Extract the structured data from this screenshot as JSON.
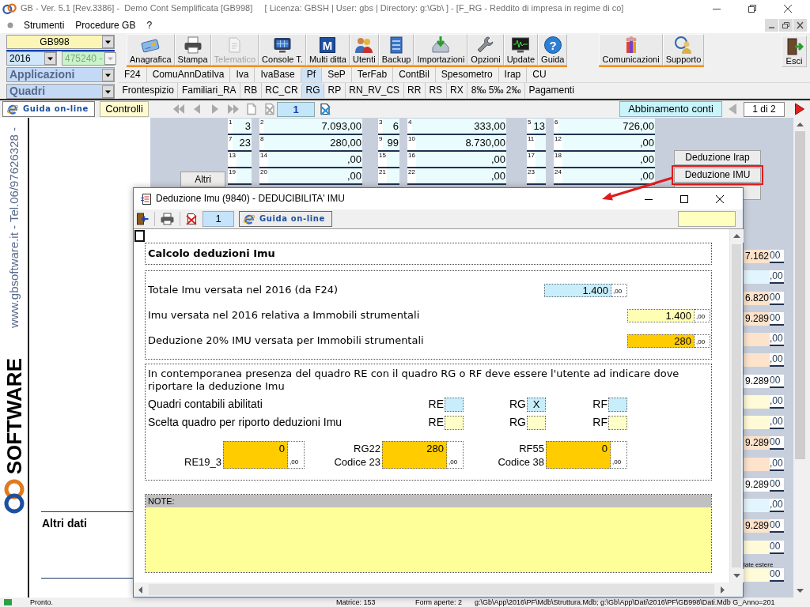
{
  "window": {
    "title": "GB - Ver. 5.1 [Rev.3386] -  Demo Cont Semplificata [GB998]     [ Licenza: GBSH | User: gbs | Directory: g:\\Gb\\ ] - [F_RG - Reddito di impresa in regime di co]"
  },
  "menu": [
    "Strumenti",
    "Procedure GB",
    "?"
  ],
  "selectors": {
    "company": "GB998",
    "year": "2016",
    "code": {
      "value": "475240 -",
      "disabled": true
    },
    "applications": "Applicazioni",
    "sections": "Quadri"
  },
  "toolbar_groups": [
    {
      "buttons": [
        {
          "label": "Anagrafica",
          "kind": "registry",
          "disabled": false
        },
        {
          "label": "Stampa",
          "kind": "print",
          "disabled": false
        },
        {
          "label": "Telematico",
          "kind": "telematic",
          "disabled": true
        },
        {
          "label": "Console T.",
          "kind": "console",
          "disabled": false
        },
        {
          "label": "Multi ditta",
          "kind": "multi",
          "glyph": "M",
          "disabled": false
        },
        {
          "label": "Utenti",
          "kind": "users",
          "disabled": false
        },
        {
          "label": "Backup",
          "kind": "backup",
          "disabled": false
        },
        {
          "label": "Importazioni",
          "kind": "import",
          "disabled": false
        },
        {
          "label": "Opzioni",
          "kind": "options",
          "disabled": false
        },
        {
          "label": "Update",
          "kind": "update",
          "disabled": false
        },
        {
          "label": "Guida",
          "kind": "help",
          "glyph": "?",
          "disabled": false
        }
      ]
    },
    {
      "buttons": [
        {
          "label": "Comunicazioni",
          "kind": "messages",
          "disabled": false
        },
        {
          "label": "Supporto",
          "kind": "support",
          "disabled": false
        }
      ]
    },
    {
      "buttons": [
        {
          "label": "Esci",
          "kind": "exit",
          "disabled": false
        }
      ]
    }
  ],
  "app_tabs": [
    {
      "label": "F24",
      "selected": false
    },
    {
      "label": "ComuAnnDatiIva",
      "selected": false
    },
    {
      "label": "Iva",
      "selected": false
    },
    {
      "label": "IvaBase",
      "selected": false
    },
    {
      "label": "Pf",
      "selected": true
    },
    {
      "label": "SeP",
      "selected": false
    },
    {
      "label": "TerFab",
      "selected": false
    },
    {
      "label": "ContBil",
      "selected": false
    },
    {
      "label": "Spesometro",
      "selected": false
    },
    {
      "label": "Irap",
      "selected": false
    },
    {
      "label": "CU",
      "selected": false
    }
  ],
  "section_tabs": [
    {
      "label": "Frontespizio",
      "selected": false
    },
    {
      "label": "Familiari_RA",
      "selected": false
    },
    {
      "label": "RB",
      "selected": false
    },
    {
      "label": "RC_CR",
      "selected": false
    },
    {
      "label": "RG",
      "selected": true
    },
    {
      "label": "RP",
      "selected": false
    },
    {
      "label": "RN_RV_CS",
      "selected": false
    },
    {
      "label": "RR",
      "selected": false
    },
    {
      "label": "RS",
      "selected": false
    },
    {
      "label": "RX",
      "selected": false
    },
    {
      "label": "8‰ 5‰ 2‰",
      "selected": false
    },
    {
      "label": "Pagamenti",
      "selected": false
    }
  ],
  "nav_bar": {
    "help_button": "Guida on-line",
    "checks_button": "Controlli",
    "record": "1",
    "link_button": "Abbinamento conti",
    "page": "1 di 2"
  },
  "side_banner": {
    "contact": "www.gbsoftware.it - Tel.06/97626328 -",
    "logo_text": "SOFTWARE"
  },
  "form": {
    "grid_rows": [
      {
        "cells": [
          {
            "number": "1",
            "value": "3"
          },
          {
            "number": "2",
            "value": "7.093,00"
          },
          {
            "number": "3",
            "value": "6"
          },
          {
            "number": "4",
            "value": "333,00"
          },
          {
            "number": "5",
            "value": "13"
          },
          {
            "number": "6",
            "value": "726,00"
          }
        ]
      },
      {
        "cells": [
          {
            "number": "7",
            "value": "23"
          },
          {
            "number": "8",
            "value": "280,00"
          },
          {
            "number": "9",
            "value": "99"
          },
          {
            "number": "10",
            "value": "8.730,00"
          },
          {
            "number": "11"
          },
          {
            "number": "12",
            "value": ",00"
          }
        ]
      },
      {
        "cells": [
          {
            "number": "13"
          },
          {
            "number": "14",
            "value": ",00"
          },
          {
            "number": "15"
          },
          {
            "number": "16",
            "value": ",00"
          },
          {
            "number": "17"
          },
          {
            "number": "18",
            "value": ",00"
          }
        ]
      },
      {
        "cells": [
          {
            "number": "19"
          },
          {
            "number": "20",
            "value": ",00"
          },
          {
            "number": "21"
          },
          {
            "number": "22",
            "value": ",00"
          },
          {
            "number": "23"
          },
          {
            "number": "24",
            "value": ",00"
          }
        ]
      }
    ],
    "other_button": "Altri",
    "side_buttons": [
      {
        "label": "Deduzione Irap",
        "highlighted": false
      },
      {
        "label": "Deduzione IMU",
        "highlighted": true
      },
      {
        "highlighted": false
      }
    ],
    "right_fields": [
      {
        "value": "7.162",
        "decimals": "00",
        "color": "#fde3cc"
      },
      {
        "decimals": ",00",
        "color": "#e3f5fc"
      },
      {
        "value": "6.820",
        "decimals": "00",
        "color": "#fde3cc"
      },
      {
        "value": "9.289",
        "decimals": "00",
        "color": "#fde3cc"
      },
      {
        "decimals": ",00",
        "color": "#fde3cc"
      },
      {
        "decimals": ",00",
        "color": "#fde3cc"
      },
      {
        "value": "9.289",
        "decimals": "00",
        "color": "#ffffff"
      },
      {
        "decimals": ",00",
        "color": "#fffbd8"
      },
      {
        "decimals": ",00",
        "color": "#fffbd8"
      },
      {
        "value": "9.289",
        "decimals": "00",
        "color": "#fde3cc"
      },
      {
        "decimals": ",00",
        "color": "#fde3cc"
      },
      {
        "value": "9.289",
        "decimals": "00",
        "color": "#ffffff"
      },
      {
        "decimals": ",00",
        "color": "#e3f5fc"
      },
      {
        "value": "9.289",
        "decimals": "00",
        "color": "#fde3cc"
      },
      {
        "decimals": "00",
        "color": "#fffbd8"
      },
      {
        "label": "late estere",
        "decimals": "00",
        "color": "#fffbd8"
      }
    ],
    "section_title": "Altri dati"
  },
  "dialog": {
    "title": "Deduzione Imu (9840) - DEDUCIBILITA' IMU",
    "record": "1",
    "help_button": "Guida on-line",
    "heading": "Calcolo deduzioni Imu",
    "amounts": [
      {
        "label": "Totale Imu versata nel 2016 (da F24)",
        "value": "1.400",
        "decimals": ",00",
        "color": "#c8eefb"
      },
      {
        "label": "Imu versata nel 2016 relativa a Immobili strumentali",
        "value": "1.400",
        "decimals": ",00",
        "color": "#ffffb4"
      },
      {
        "label": "Deduzione 20% IMU versata per Immobili strumentali",
        "value": "280",
        "decimals": ",00",
        "color": "#ffcc00"
      }
    ],
    "instructions": "In contemporanea presenza del quadro RE con il quadro RG o RF deve essere l'utente ad indicare dove riportare la deduzione Imu",
    "choice_rows": [
      {
        "label": "Quadri contabili abilitati",
        "color": "#c8eefb",
        "options": [
          {
            "code": "RE"
          },
          {
            "code": "RG",
            "value": "X"
          },
          {
            "code": "RF"
          }
        ]
      },
      {
        "label": "Scelta quadro per riporto deduzioni Imu",
        "color": "#ffffc8",
        "options": [
          {
            "code": "RE"
          },
          {
            "code": "RG"
          },
          {
            "code": "RF"
          }
        ]
      }
    ],
    "transfers": [
      {
        "labels": [
          "RE19_3"
        ],
        "value": "0",
        "decimals": ",00"
      },
      {
        "labels": [
          "RG22",
          "Codice 23"
        ],
        "value": "280",
        "decimals": ",00"
      },
      {
        "labels": [
          "RF55",
          "Codice 38"
        ],
        "value": "0",
        "decimals": ",00"
      }
    ],
    "notes_label": "NOTE:"
  },
  "status_bar": {
    "state": "Pronto.",
    "matrix": "Matrice: 153",
    "open_forms": "Form aperte: 2",
    "paths": "g:\\Gb\\App\\2016\\PF\\Mdb\\Struttura.Mdb; g:\\Gb\\App\\Dati\\2016\\PF\\GB998\\Dati.Mdb G_Anno=201"
  }
}
